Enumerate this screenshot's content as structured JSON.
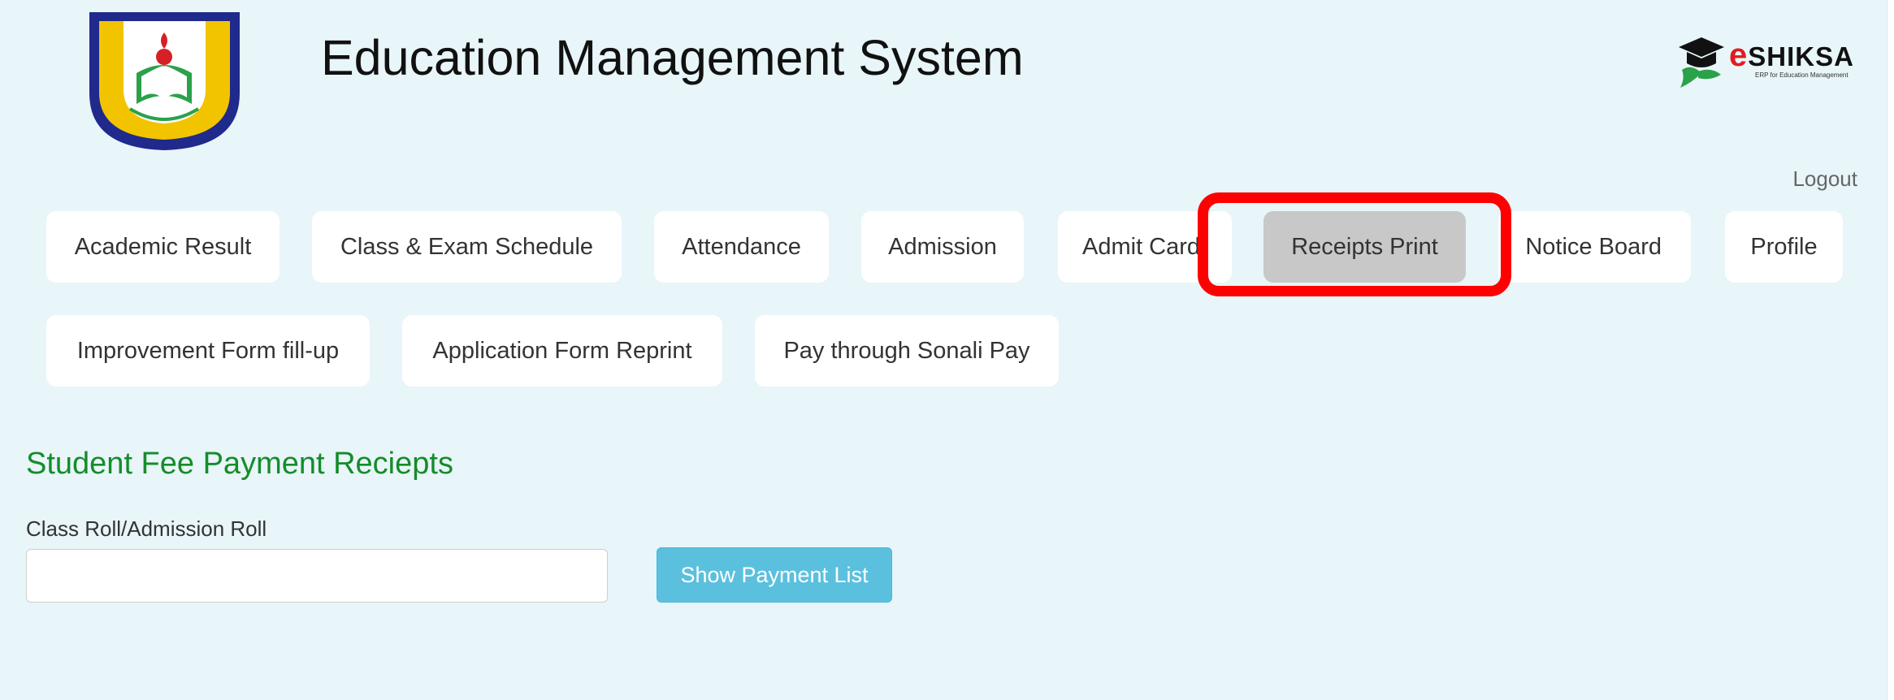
{
  "header": {
    "title": "Education Management System",
    "brand": {
      "name_e": "e",
      "name_rest": "SHIKSA",
      "tagline": "ERP for Education Management"
    },
    "logout_label": "Logout"
  },
  "nav": {
    "row1": [
      "Academic Result",
      "Class & Exam Schedule",
      "Attendance",
      "Admission",
      "Admit Card",
      "Receipts Print",
      "Notice Board",
      "Profile"
    ],
    "row2": [
      "Improvement Form fill-up",
      "Application Form Reprint",
      "Pay through Sonali Pay"
    ],
    "active": "Receipts Print"
  },
  "main": {
    "section_title": "Student Fee Payment Reciepts",
    "roll_label": "Class Roll/Admission Roll",
    "roll_value": "",
    "show_button_label": "Show Payment List"
  },
  "colors": {
    "panel_background": "#e8f5f9",
    "section_title": "#158c2a",
    "primary_button": "#5bc0de",
    "active_tab": "#c8c8c8",
    "highlight": "#ff0000"
  },
  "icons": {
    "college_logo": "college-emblem-icon",
    "brand_logo": "graduation-cap-icon"
  }
}
